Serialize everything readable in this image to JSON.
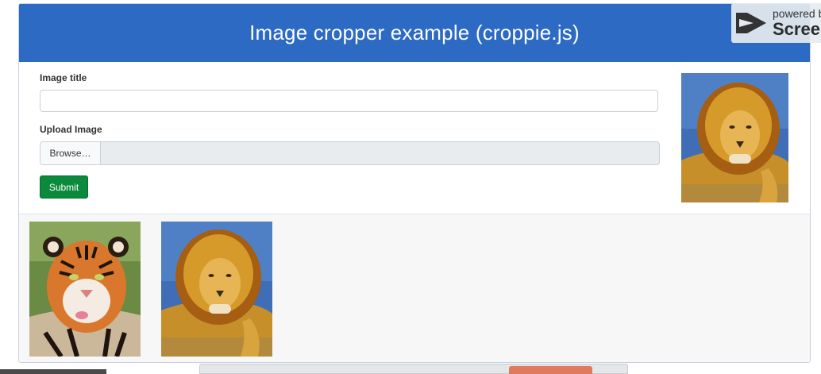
{
  "header": {
    "title": "Image cropper example (croppie.js)"
  },
  "form": {
    "image_title_label": "Image title",
    "image_title_value": "",
    "upload_label": "Upload Image",
    "browse_label": "Browse…",
    "file_name": "",
    "submit_label": "Submit"
  },
  "preview": {
    "subject": "lion"
  },
  "gallery": {
    "items": [
      {
        "subject": "tiger"
      },
      {
        "subject": "lion"
      }
    ]
  },
  "watermark": {
    "line1": "powered by",
    "line2": "Screencast-O-Matic"
  },
  "colors": {
    "header": "#2c6ac3",
    "submit": "#0a8a3a",
    "gallery_bg": "#f7f7f8"
  },
  "icons": {
    "watermark": "play-icon"
  }
}
